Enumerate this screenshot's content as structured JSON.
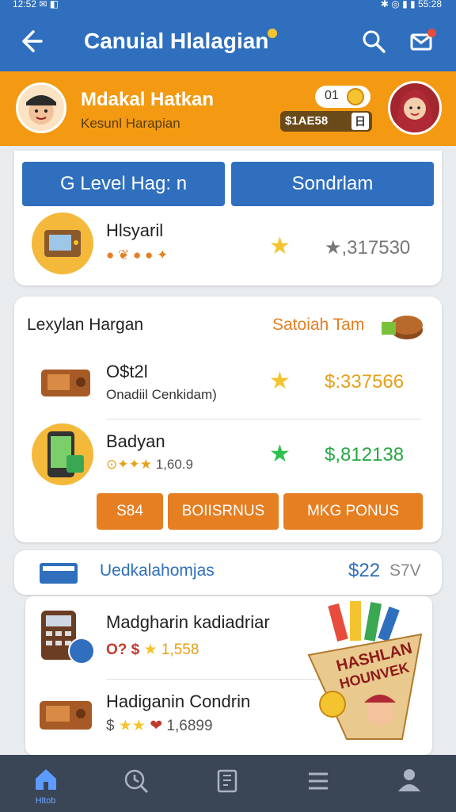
{
  "status_bar": {
    "left": "12:52 ✉ ◧",
    "right": "✱ ◎ ▮ ▮ 55:28"
  },
  "app_bar": {
    "title": "Canuial Hlalagian",
    "icons": [
      "back-arrow-icon",
      "search-icon",
      "mail-icon"
    ]
  },
  "profile": {
    "name": "Mdakal Hatkan",
    "subtitle": "Kesunl Harapian",
    "coin_count": "01",
    "money": "$1AE58",
    "money_box": "日"
  },
  "top_card": {
    "level_button": "Level Hag:  n",
    "level_icon": "G",
    "second_button": "Sondrlam",
    "item": {
      "name": "Hlsyaril",
      "meta": "● ❦ ● ● ✦",
      "price": "★,317530"
    }
  },
  "section": {
    "title": "Lexylan Hargan",
    "link": "Satoiah Tam",
    "items": [
      {
        "name": "O$t2l",
        "sub": "Onadiil Cenkidam)",
        "price": "$:337566",
        "price_color": "#e6a017",
        "star_color": "#f4c430"
      },
      {
        "name": "Badyan",
        "sub": "1,60.9",
        "price": "$,812138",
        "price_color": "#27a844",
        "star_color": "#2fbf4e"
      }
    ],
    "buttons": [
      "S84",
      "BOIISRNUS",
      "MKG PONUS"
    ]
  },
  "promo": {
    "title": "Uedkalahomjas",
    "amount": "$22",
    "amount_suffix": "S7V"
  },
  "list": [
    {
      "name": "Madgharin kadiadriar",
      "meta": "1,558",
      "prefix": "O? $"
    },
    {
      "name": "Hadiganin Condrin",
      "meta": "1,6899",
      "prefix": "$"
    }
  ],
  "promo_image_text": [
    "HASHLAN",
    "HOUNVEK"
  ],
  "bottom_nav": [
    {
      "icon": "home-icon",
      "label": "Hltob"
    },
    {
      "icon": "clock-search-icon",
      "label": ""
    },
    {
      "icon": "book-icon",
      "label": ""
    },
    {
      "icon": "menu-icon",
      "label": ""
    },
    {
      "icon": "person-icon",
      "label": ""
    }
  ],
  "colors": {
    "primary": "#2f6fbd",
    "accent": "#f39a12",
    "orange_button": "#e67e22",
    "nav_bg": "#3a4556"
  }
}
